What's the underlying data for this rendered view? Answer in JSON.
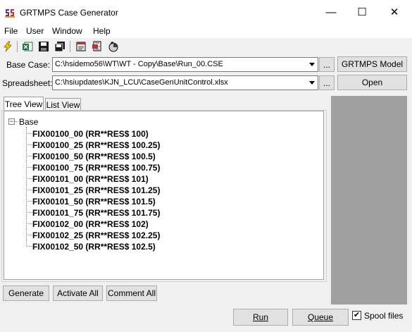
{
  "window": {
    "title": "GRTMPS Case Generator",
    "minimize_glyph": "—",
    "maximize_glyph": "☐",
    "close_glyph": "✕"
  },
  "menu": [
    "File",
    "User",
    "Window",
    "Help"
  ],
  "toolbar": {
    "icons": [
      "lightning-icon",
      "excel-icon",
      "save-icon",
      "save-all-icon",
      "notes-icon",
      "report-icon",
      "stamp-icon",
      "chart-icon"
    ]
  },
  "base_case": {
    "label": "Base Case:",
    "value": "C:\\hsidemo56\\WT\\WT - Copy\\Base\\Run_00.CSE",
    "browse_label": "...",
    "model_button": "GRTMPS Model"
  },
  "spreadsheet": {
    "label": "Spreadsheet:",
    "value": "C:\\hsiupdates\\KJN_LCU\\CaseGenUnitControl.xlsx",
    "browse_label": "...",
    "open_button": "Open"
  },
  "tabs": [
    {
      "label": "Tree View",
      "active": true
    },
    {
      "label": "List View",
      "active": false
    }
  ],
  "tree": {
    "root_toggle": "−",
    "root_label": "Base",
    "items": [
      "FIX00100_00 (RR**RES$ 100)",
      "FIX00100_25 (RR**RES$ 100.25)",
      "FIX00100_50 (RR**RES$ 100.5)",
      "FIX00100_75 (RR**RES$ 100.75)",
      "FIX00101_00 (RR**RES$ 101)",
      "FIX00101_25 (RR**RES$ 101.25)",
      "FIX00101_50 (RR**RES$ 101.5)",
      "FIX00101_75 (RR**RES$ 101.75)",
      "FIX00102_00 (RR**RES$ 102)",
      "FIX00102_25 (RR**RES$ 102.25)",
      "FIX00102_50 (RR**RES$ 102.5)"
    ]
  },
  "actions": {
    "generate": "Generate",
    "activate_all": "Activate All",
    "comment_all": "Comment All"
  },
  "footer": {
    "run": "Run",
    "queue": "Queue",
    "spool_label": "Spool files",
    "spool_checked": true,
    "check_glyph": "✔"
  }
}
